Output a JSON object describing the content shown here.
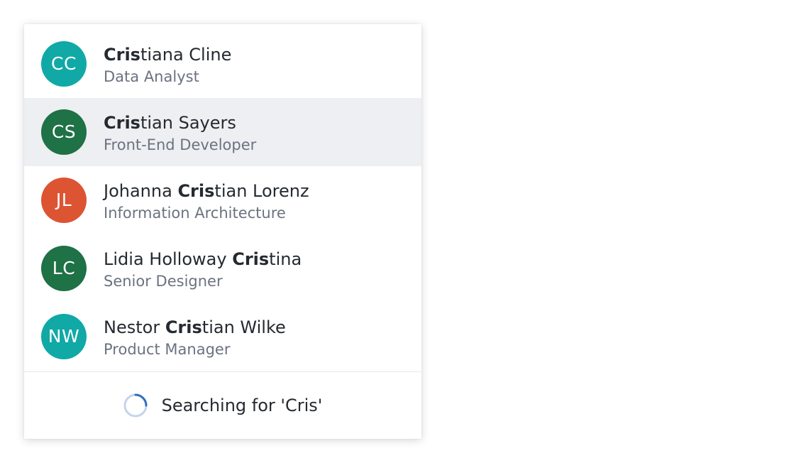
{
  "colors": {
    "teal": "#10a9a6",
    "green": "#1f7146",
    "orange": "#dd5433",
    "selected_bg": "#edeff2",
    "spinner": "#2f6ec1",
    "spinner_track": "#c6d3ea"
  },
  "query": "Cris",
  "people": [
    {
      "initials": "CC",
      "name_before": "",
      "name_match": "Cris",
      "name_after": "tiana Cline",
      "role": "Data Analyst",
      "avatar_color": "#10a9a6",
      "selected": false
    },
    {
      "initials": "CS",
      "name_before": "",
      "name_match": "Cris",
      "name_after": "tian Sayers",
      "role": "Front-End Developer",
      "avatar_color": "#1f7146",
      "selected": true
    },
    {
      "initials": "JL",
      "name_before": "Johanna ",
      "name_match": "Cris",
      "name_after": "tian Lorenz",
      "role": "Information Architecture",
      "avatar_color": "#dd5433",
      "selected": false
    },
    {
      "initials": "LC",
      "name_before": "Lidia Holloway ",
      "name_match": "Cris",
      "name_after": "tina",
      "role": "Senior Designer",
      "avatar_color": "#1f7146",
      "selected": false
    },
    {
      "initials": "NW",
      "name_before": "Nestor ",
      "name_match": "Cris",
      "name_after": "tian Wilke",
      "role": "Product Manager",
      "avatar_color": "#10a9a6",
      "selected": false
    }
  ],
  "status": {
    "text": "Searching for 'Cris'"
  }
}
